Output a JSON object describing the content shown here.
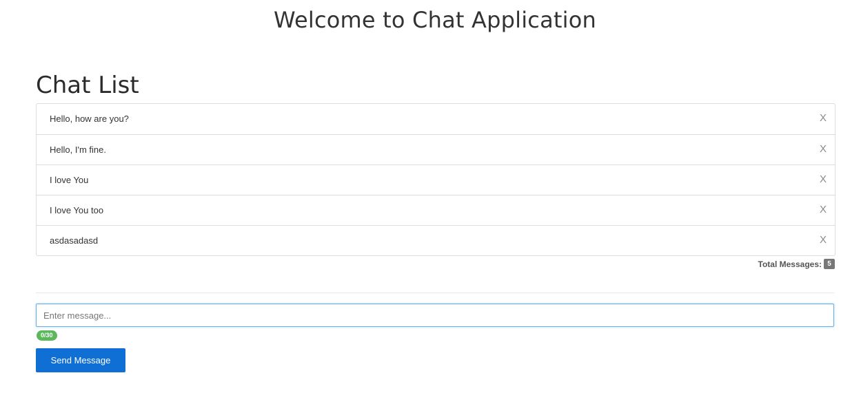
{
  "header": {
    "title": "Welcome to Chat Application"
  },
  "chat_list": {
    "title": "Chat List",
    "messages": [
      {
        "text": "Hello, how are you?",
        "delete_label": "X"
      },
      {
        "text": "Hello, I'm fine.",
        "delete_label": "X"
      },
      {
        "text": "I love You",
        "delete_label": "X"
      },
      {
        "text": "I love You too",
        "delete_label": "X"
      },
      {
        "text": "asdasadasd",
        "delete_label": "X"
      }
    ],
    "total_label": "Total Messages:",
    "total_count": "5"
  },
  "composer": {
    "placeholder": "Enter message...",
    "value": "",
    "char_counter": "0/30",
    "send_label": "Send Message"
  },
  "colors": {
    "send_button": "#0f6fd4",
    "counter_badge": "#5cb85c",
    "total_badge": "#777777",
    "input_focus_border": "#66afe9"
  }
}
